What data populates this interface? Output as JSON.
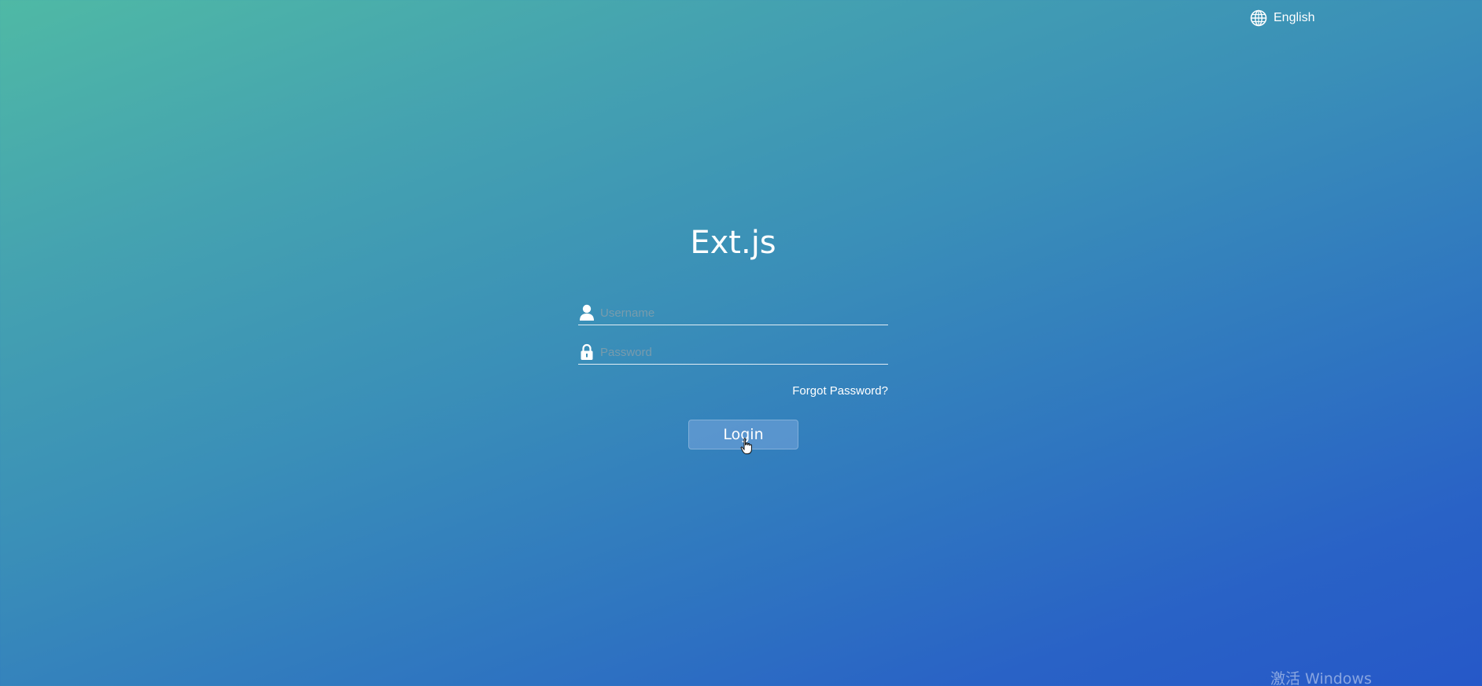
{
  "header": {
    "language_label": "English",
    "language_icon": "globe-icon"
  },
  "app": {
    "title": "Ext.js"
  },
  "form": {
    "username": {
      "icon": "user-icon",
      "placeholder": "Username",
      "value": ""
    },
    "password": {
      "icon": "lock-icon",
      "placeholder": "Password",
      "value": ""
    },
    "forgot_password_label": "Forgot Password?",
    "login_label": "Login"
  },
  "system": {
    "watermark": "激活 Windows"
  },
  "colors": {
    "gradient_top_left": "#4fb9a5",
    "gradient_bottom_right": "#2658c8",
    "text": "#ffffff"
  }
}
